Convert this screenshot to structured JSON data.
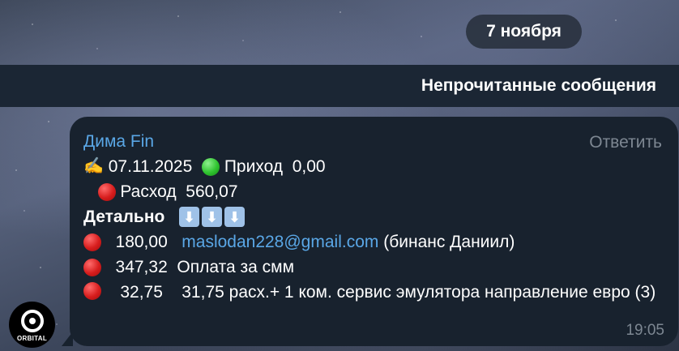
{
  "date_pill": "7 ноября",
  "unread_banner": "Непрочитанные сообщения",
  "avatar": {
    "label": "ORBITAL"
  },
  "message": {
    "sender": "Дима Fin",
    "reply_label": "Ответить",
    "pen_emoji": "✍️",
    "date": "07.11.2025",
    "income_label": "Приход",
    "income_value": "0,00",
    "expense_label": "Расход",
    "expense_value": "560,07",
    "details_label": "Детально",
    "arrow_glyph": "⬇",
    "items": [
      {
        "amount": "180,00",
        "email": "maslodan228@gmail.com",
        "note": "(бинанс Даниил)"
      },
      {
        "amount": "347,32",
        "note": "Оплата за смм"
      },
      {
        "amount": "32,75",
        "note": "31,75 расх.+ 1 ком. сервис эмулятора направление евро (3)"
      }
    ],
    "time": "19:05"
  }
}
